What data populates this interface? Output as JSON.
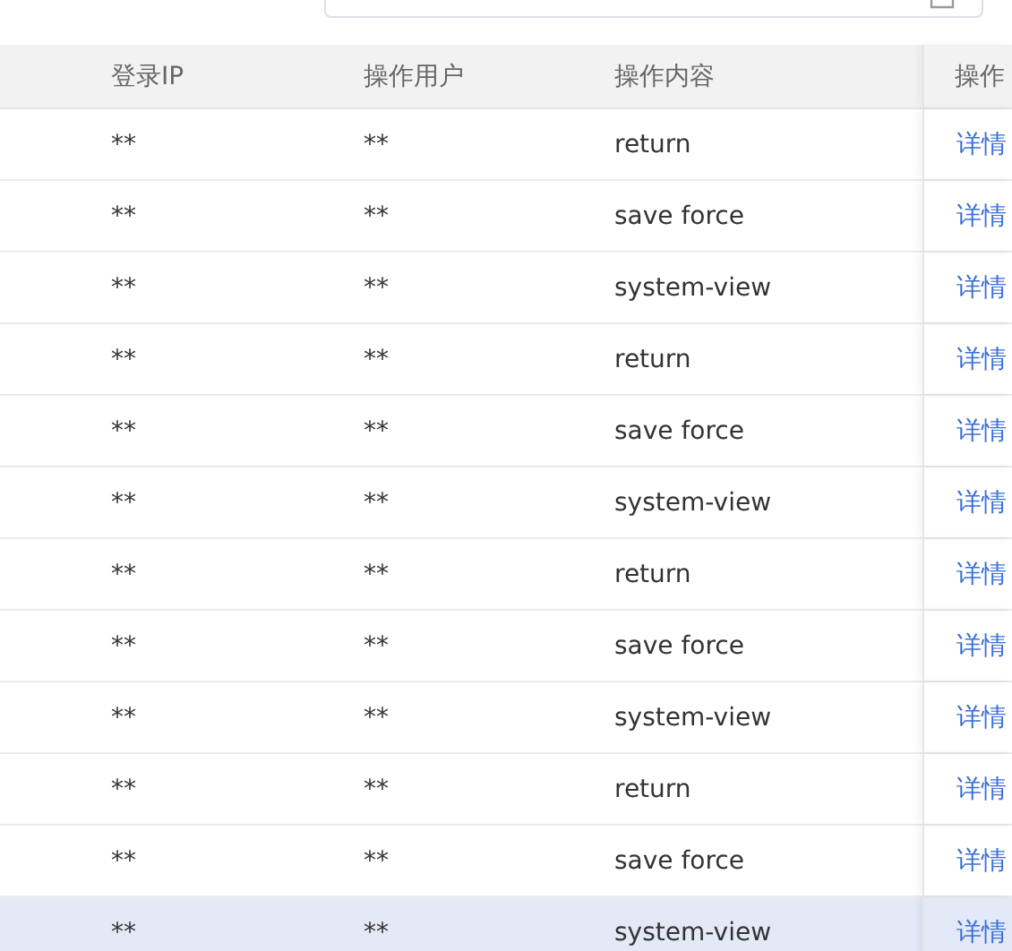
{
  "table": {
    "columns": [
      "登录IP",
      "操作用户",
      "操作内容",
      "操作"
    ],
    "rows": [
      {
        "ip": "**",
        "user": "**",
        "content": "return",
        "action": "详情",
        "selected": false
      },
      {
        "ip": "**",
        "user": "**",
        "content": "save force",
        "action": "详情",
        "selected": false
      },
      {
        "ip": "**",
        "user": "**",
        "content": "system-view",
        "action": "详情",
        "selected": false
      },
      {
        "ip": "**",
        "user": "**",
        "content": "return",
        "action": "详情",
        "selected": false
      },
      {
        "ip": "**",
        "user": "**",
        "content": "save force",
        "action": "详情",
        "selected": false
      },
      {
        "ip": "**",
        "user": "**",
        "content": "system-view",
        "action": "详情",
        "selected": false
      },
      {
        "ip": "**",
        "user": "**",
        "content": "return",
        "action": "详情",
        "selected": false
      },
      {
        "ip": "**",
        "user": "**",
        "content": "save force",
        "action": "详情",
        "selected": false
      },
      {
        "ip": "**",
        "user": "**",
        "content": "system-view",
        "action": "详情",
        "selected": false
      },
      {
        "ip": "**",
        "user": "**",
        "content": "return",
        "action": "详情",
        "selected": false
      },
      {
        "ip": "**",
        "user": "**",
        "content": "save force",
        "action": "详情",
        "selected": false
      },
      {
        "ip": "**",
        "user": "**",
        "content": "system-view",
        "action": "详情",
        "selected": true
      }
    ]
  }
}
